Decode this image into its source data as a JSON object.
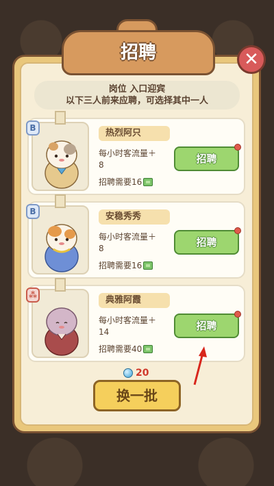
{
  "title": "招聘",
  "close_icon": "close-icon",
  "info": {
    "position_line": "岗位 入口迎宾",
    "desc_line": "以下三人前来应聘，可选择其中一人"
  },
  "candidates": [
    {
      "rank": "B",
      "name": "热烈阿只",
      "traffic_label": "每小时客流量＋",
      "traffic_value": "8",
      "cost_label": "招聘需要",
      "cost_value": "16",
      "hire_label": "招聘",
      "outfit_color": "#e6c98d"
    },
    {
      "rank": "B",
      "name": "安稳秀秀",
      "traffic_label": "每小时客流量＋",
      "traffic_value": "8",
      "cost_label": "招聘需要",
      "cost_value": "16",
      "hire_label": "招聘",
      "outfit_color": "#6e8fd6"
    },
    {
      "rank": "⁂",
      "name": "典雅阿霞",
      "traffic_label": "每小时客流量＋",
      "traffic_value": "14",
      "cost_label": "招聘需要",
      "cost_value": "40",
      "hire_label": "招聘",
      "outfit_color": "#a94c4c"
    }
  ],
  "gem_count": "20",
  "refresh_label": "换一批",
  "colors": {
    "accent_green": "#9dd66f",
    "panel": "#e9c77c",
    "refresh": "#f5cf5c",
    "annotation_arrow": "#d8261c"
  }
}
